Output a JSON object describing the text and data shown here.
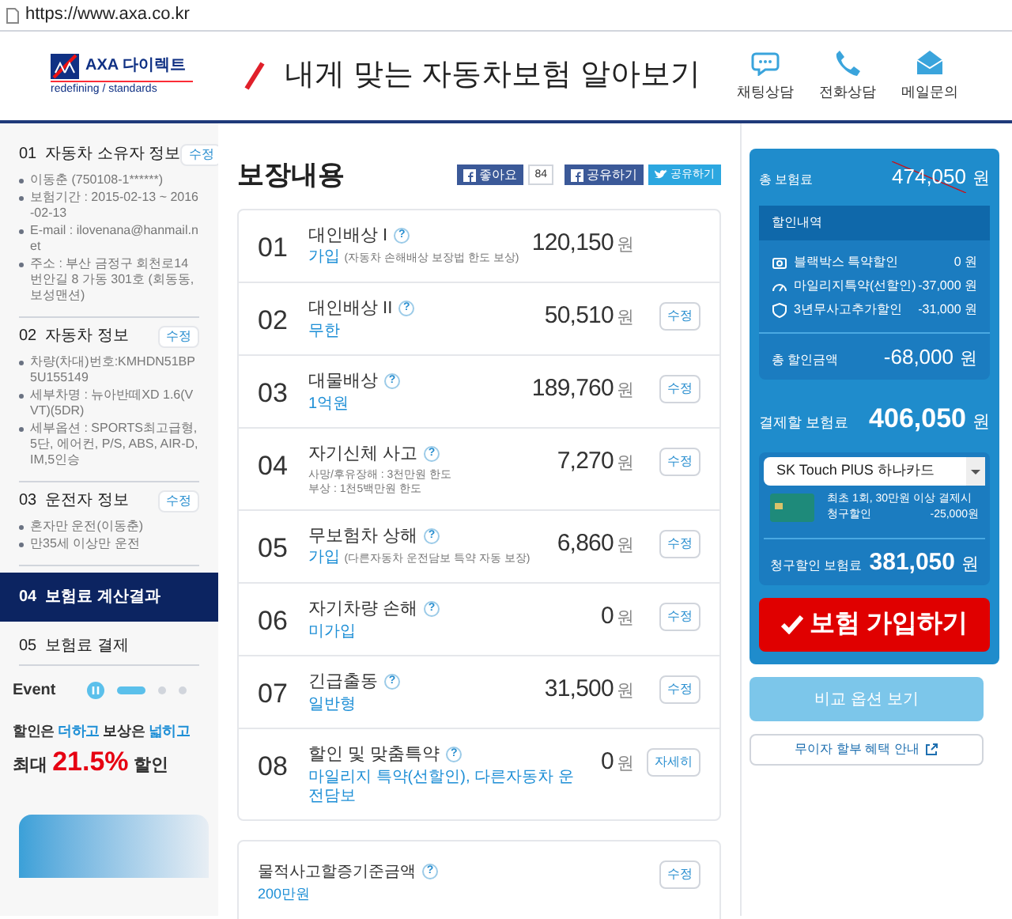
{
  "browser": {
    "url": "https://www.axa.co.kr"
  },
  "header": {
    "logo_text": "AXA 다이렉트",
    "logo_tagline": "redefining / standards",
    "title": "내게 맞는 자동차보험 알아보기",
    "actions": [
      {
        "kind": "chat",
        "label": "채팅상담"
      },
      {
        "kind": "phone",
        "label": "전화상담"
      },
      {
        "kind": "mail",
        "label": "메일문의"
      }
    ]
  },
  "sidebar": {
    "steps": [
      {
        "no": "01",
        "title": "자동차 소유자 정보",
        "edit": "수정",
        "selected": false,
        "items": [
          "이동춘 (750108-1******)",
          "보험기간 : 2015-02-13 ~ 2016-02-13",
          "E-mail : ilovenana@hanmail.net",
          "주소 : 부산 금정구 회천로14번안길 8 가동 301호 (회동동,보성맨션)"
        ]
      },
      {
        "no": "02",
        "title": "자동차 정보",
        "edit": "수정",
        "selected": false,
        "items": [
          "차량(차대)번호:KMHDN51BP5U155149",
          "세부차명 : 뉴아반떼XD 1.6(VVT)(5DR)",
          "세부옵션 : SPORTS최고급형, 5단, 에어컨, P/S, ABS, AIR-D, IM,5인승"
        ]
      },
      {
        "no": "03",
        "title": "운전자 정보",
        "edit": "수정",
        "selected": false,
        "items": [
          "혼자만 운전(이동춘)",
          "만35세 이상만 운전"
        ]
      },
      {
        "no": "04",
        "title": "보험료 계산결과",
        "selected": true
      },
      {
        "no": "05",
        "title": "보험료 결제",
        "selected": false
      }
    ],
    "event": {
      "label": "Event",
      "line1": "할인은 **더하고** 보상은 **넓히고**",
      "line2": "최대 **21.5%** 할인",
      "slides": [
        {
          "selected": true
        },
        {
          "selected": false
        },
        {
          "selected": false
        }
      ]
    }
  },
  "coverage": {
    "title": "보장내용",
    "social": {
      "like": "좋아요",
      "like_count": "84",
      "share": "공유하기",
      "tweet": "공유하기"
    },
    "rows": [
      {
        "no": "01",
        "title": "대인배상 I",
        "help": "?",
        "value": "가입",
        "note": "(자동차 손해배상 보장법 한도 보상)",
        "amount": "120,150",
        "unit": "원"
      },
      {
        "no": "02",
        "title": "대인배상 II",
        "help": "?",
        "value": "무한",
        "amount": "50,510",
        "unit": "원",
        "button": "수정"
      },
      {
        "no": "03",
        "title": "대물배상",
        "help": "?",
        "value": "1억원",
        "amount": "189,760",
        "unit": "원",
        "button": "수정"
      },
      {
        "no": "04",
        "title": "자기신체 사고",
        "help": "?",
        "details": [
          "사망/후유장해 : 3천만원 한도",
          "부상 : 1천5백만원 한도"
        ],
        "amount": "7,270",
        "unit": "원",
        "button": "수정"
      },
      {
        "no": "05",
        "title": "무보험차 상해",
        "help": "?",
        "value": "가입",
        "note": "(다른자동차 운전담보 특약 자동 보장)",
        "amount": "6,860",
        "unit": "원",
        "button": "수정"
      },
      {
        "no": "06",
        "title": "자기차량 손해",
        "help": "?",
        "value": "미가입",
        "amount": "0",
        "unit": "원",
        "button": "수정"
      },
      {
        "no": "07",
        "title": "긴급출동",
        "help": "?",
        "value": "일반형",
        "amount": "31,500",
        "unit": "원",
        "button": "수정"
      },
      {
        "no": "08",
        "title": "할인 및 맞춤특약",
        "help": "?",
        "value": "마일리지 특약(선할인), 다른자동차 운전담보",
        "amount": "0",
        "unit": "원",
        "button": "자세히"
      }
    ],
    "extra": {
      "title": "물적사고할증기준금액",
      "help": "?",
      "value": "200만원",
      "button": "수정"
    }
  },
  "summary": {
    "total_label": "총 보험료",
    "total": "474,050",
    "total_unit": "원",
    "discount_title": "할인내역",
    "discounts": [
      {
        "kind": "camera",
        "label": "블랙박스 특약할인",
        "amount": "0 원"
      },
      {
        "kind": "gauge",
        "label": "마일리지특약(선할인)",
        "amount": "-37,000 원"
      },
      {
        "kind": "shield",
        "label": "3년무사고추가할인",
        "amount": "-31,000 원"
      }
    ],
    "discount_total_label": "총 할인금액",
    "discount_total": "-68,000",
    "discount_total_unit": "원",
    "pay_label": "결제할 보험료",
    "pay": "406,050",
    "pay_unit": "원",
    "card_select": "SK Touch PlUS 하나카드",
    "card_line1": "최초 1회, 30만원 이상 결제시",
    "card_line2_label": "청구할인",
    "card_line2_amount": "-25,000원",
    "billed_label": "청구할인 보험료",
    "billed": "381,050",
    "billed_unit": "원",
    "join": "보험 가입하기",
    "compare": "비교 옵션 보기",
    "installment": "무이자 할부 혜택 안내"
  }
}
